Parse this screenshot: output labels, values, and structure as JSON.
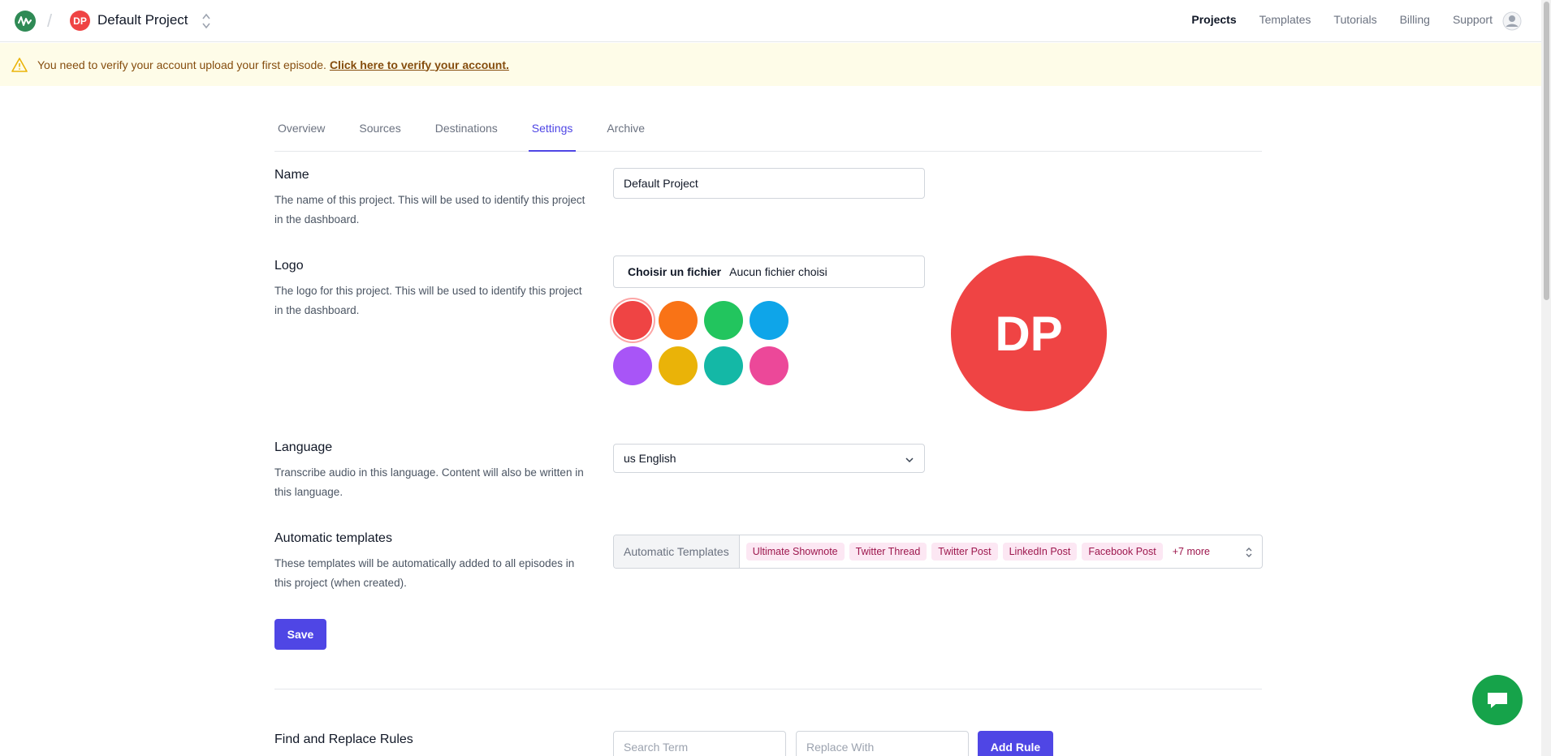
{
  "header": {
    "project_initials": "DP",
    "project_name": "Default Project",
    "nav": [
      "Projects",
      "Templates",
      "Tutorials",
      "Billing",
      "Support"
    ]
  },
  "banner": {
    "message": "You need to verify your account upload your first episode.",
    "link": "Click here to verify your account."
  },
  "tabs": [
    "Overview",
    "Sources",
    "Destinations",
    "Settings",
    "Archive"
  ],
  "name_section": {
    "title": "Name",
    "description": "The name of this project. This will be used to identify this project in the dashboard.",
    "value": "Default Project"
  },
  "logo_section": {
    "title": "Logo",
    "description": "The logo for this project. This will be used to identify this project in the dashboard.",
    "file_button": "Choisir un fichier",
    "file_status": "Aucun fichier choisi",
    "colors": [
      "#ef4444",
      "#f97316",
      "#22c55e",
      "#0ea5e9",
      "#a855f7",
      "#eab308",
      "#14b8a6",
      "#ec4899"
    ],
    "selected_color": "#ef4444",
    "preview_initials": "DP"
  },
  "language_section": {
    "title": "Language",
    "description": "Transcribe audio in this language. Content will also be written in this language.",
    "value": "us English"
  },
  "templates_section": {
    "title": "Automatic templates",
    "description": "These templates will be automatically added to all episodes in this project (when created).",
    "label": "Automatic Templates",
    "chips": [
      "Ultimate Shownote",
      "Twitter Thread",
      "Twitter Post",
      "LinkedIn Post",
      "Facebook Post"
    ],
    "more": "+7 more"
  },
  "save_label": "Save",
  "find_replace": {
    "title": "Find and Replace Rules",
    "search_placeholder": "Search Term",
    "replace_placeholder": "Replace With",
    "add_label": "Add Rule"
  }
}
